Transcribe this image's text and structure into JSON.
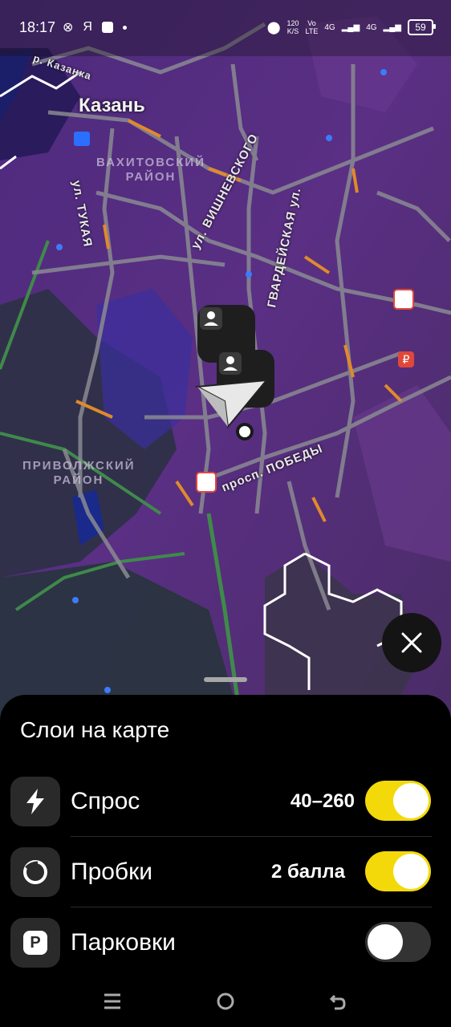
{
  "status_bar": {
    "time": "18:17",
    "left_icons": [
      "x-circle-icon",
      "yandex-icon",
      "square-icon",
      "dot-icon"
    ],
    "yandex_letter": "Я",
    "speed_value": "120",
    "speed_unit": "K/S",
    "volte_top": "Vo",
    "volte_bottom": "LTE",
    "network_1": "4G",
    "network_2": "4G",
    "battery": "59"
  },
  "map": {
    "city": "Казань",
    "districts": [
      "ВАХИТОВСКИЙ\nРАЙОН",
      "ПРИВОЛЖСКИЙ\nРАЙОН"
    ],
    "district_vahit": "ВАХИТОВСКИЙ РАЙОН",
    "district_privol": "ПРИВОЛЖСКИЙ РАЙОН",
    "streets": {
      "tukaya": "ул. ТУКАЯ",
      "vishnevskogo": "ул. ВИШНЕВСКОГО",
      "gvardeyskaya": "ГВАРДЕЙСКАЯ ул.",
      "pobedy": "просп. ПОБЕДЫ",
      "kazanka": "р. Казанка"
    }
  },
  "sheet": {
    "title": "Слои на карте",
    "layers": [
      {
        "label": "Спрос",
        "value": "40–260",
        "enabled": true,
        "icon": "lightning-icon"
      },
      {
        "label": "Пробки",
        "value": "2 балла",
        "enabled": true,
        "icon": "traffic-circle-icon"
      },
      {
        "label": "Парковки",
        "value": "",
        "enabled": false,
        "icon": "parking-icon",
        "icon_letter": "P"
      }
    ]
  },
  "colors": {
    "accent_toggle": "#f3d90a",
    "map_purple": "#5b2f86",
    "road": "#8a8a8a",
    "traffic_orange": "#e08a2a"
  }
}
